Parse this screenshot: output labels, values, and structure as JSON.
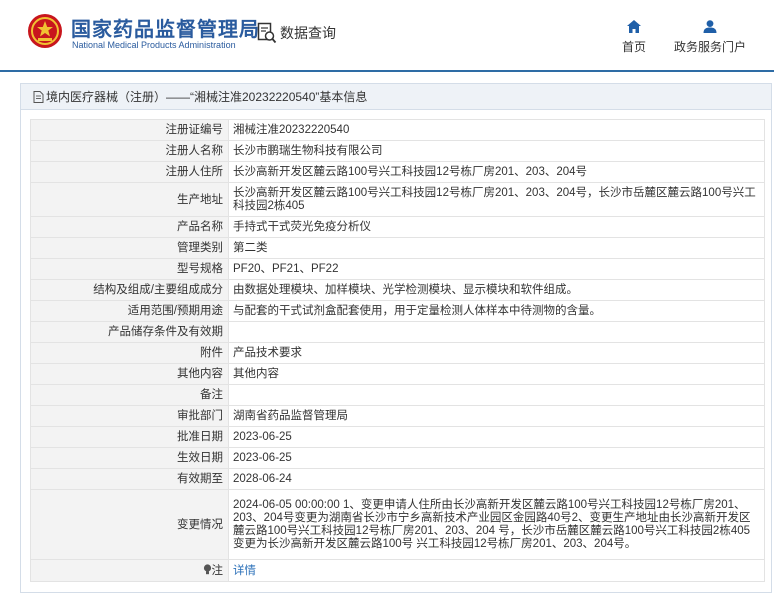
{
  "header": {
    "site_name": "国家药品监督管理局",
    "site_name_en": "National Medical Products Administration",
    "query_label": "数据查询",
    "nav": [
      {
        "label": "首页",
        "icon": "home-icon"
      },
      {
        "label": "政务服务门户",
        "icon": "user-icon"
      }
    ]
  },
  "breadcrumb": {
    "text": "境内医疗器械（注册）——“湘械注准20232220540”基本信息"
  },
  "details": {
    "rows": [
      {
        "label": "注册证编号",
        "value": "湘械注准20232220540"
      },
      {
        "label": "注册人名称",
        "value": "长沙市鹏瑞生物科技有限公司"
      },
      {
        "label": "注册人住所",
        "value": "长沙高新开发区麓云路100号兴工科技园12号栋厂房201、203、204号"
      },
      {
        "label": "生产地址",
        "value": "长沙高新开发区麓云路100号兴工科技园12号栋厂房201、203、204号，长沙市岳麓区麓云路100号兴工科技园2栋405"
      },
      {
        "label": "产品名称",
        "value": "手持式干式荧光免疫分析仪"
      },
      {
        "label": "管理类别",
        "value": "第二类"
      },
      {
        "label": "型号规格",
        "value": "PF20、PF21、PF22"
      },
      {
        "label": "结构及组成/主要组成成分",
        "value": "由数据处理模块、加样模块、光学检测模块、显示模块和软件组成。"
      },
      {
        "label": "适用范围/预期用途",
        "value": "与配套的干式试剂盒配套使用，用于定量检测人体样本中待测物的含量。"
      },
      {
        "label": "产品储存条件及有效期",
        "value": ""
      },
      {
        "label": "附件",
        "value": "产品技术要求"
      },
      {
        "label": "其他内容",
        "value": "其他内容"
      },
      {
        "label": "备注",
        "value": ""
      },
      {
        "label": "审批部门",
        "value": "湖南省药品监督管理局"
      },
      {
        "label": "批准日期",
        "value": "2023-06-25"
      },
      {
        "label": "生效日期",
        "value": "2023-06-25"
      },
      {
        "label": "有效期至",
        "value": "2028-06-24"
      },
      {
        "label": "变更情况",
        "value": "2024-06-05 00:00:00 1、变更申请人住所由长沙高新开发区麓云路100号兴工科技园12号栋厂房201、203、204号变更为湖南省长沙市宁乡高新技术产业园区金园路40号2、变更生产地址由长沙高新开发区麓云路100号兴工科技园12号栋厂房201、203、204 号，长沙市岳麓区麓云路100号兴工科技园2栋405变更为长沙高新开发区麓云路100号 兴工科技园12号栋厂房201、203、204号。"
      }
    ],
    "note": {
      "label": "注",
      "value": "详情",
      "icon": "bulb-icon"
    }
  }
}
